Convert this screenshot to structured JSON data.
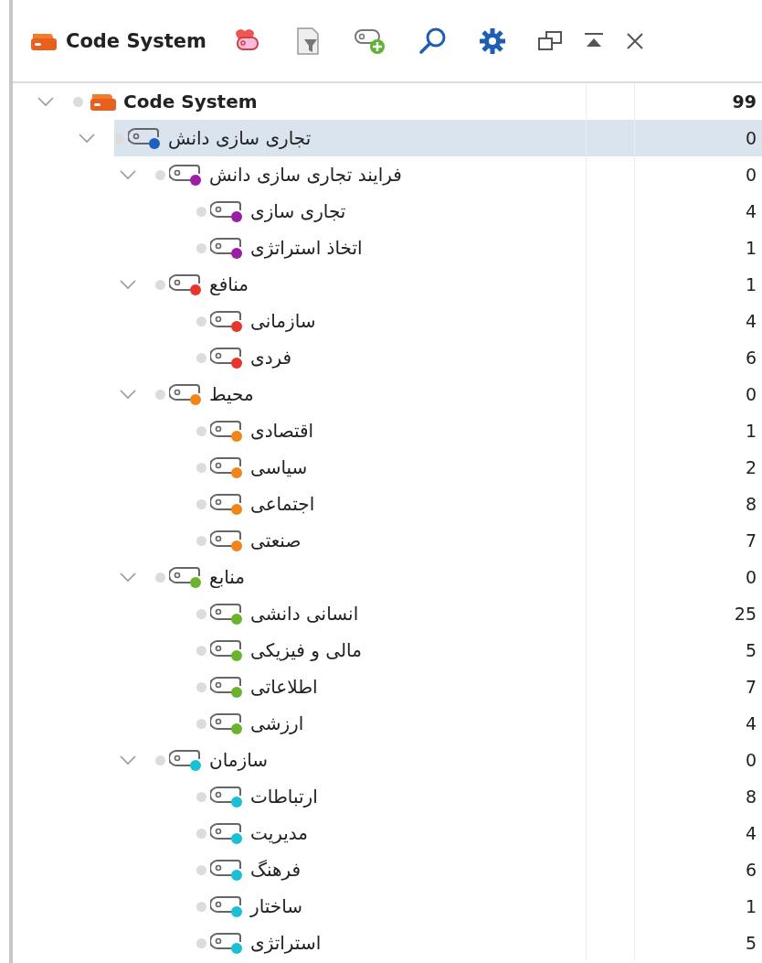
{
  "toolbar": {
    "title": "Code System"
  },
  "tree": [
    {
      "kind": "system",
      "label": "Code System",
      "count": "99",
      "selected": false,
      "expanded": true,
      "children": [
        {
          "kind": "code",
          "label": "تجاری سازی دانش",
          "count": "0",
          "color": "#1f5fbf",
          "selected": true,
          "expanded": true,
          "children": [
            {
              "kind": "code",
              "label": "فرایند تجاری سازی دانش",
              "count": "0",
              "color": "#9b1fa6",
              "selected": false,
              "expanded": true,
              "children": [
                {
                  "kind": "code",
                  "label": "تجاری سازی",
                  "count": "4",
                  "color": "#9b1fa6",
                  "selected": false
                },
                {
                  "kind": "code",
                  "label": "اتخاذ استراتژی",
                  "count": "1",
                  "color": "#9b1fa6",
                  "selected": false
                }
              ]
            },
            {
              "kind": "code",
              "label": "منافع",
              "count": "1",
              "color": "#e8352b",
              "selected": false,
              "expanded": true,
              "children": [
                {
                  "kind": "code",
                  "label": "سازمانی",
                  "count": "4",
                  "color": "#e8352b",
                  "selected": false
                },
                {
                  "kind": "code",
                  "label": "فردی",
                  "count": "6",
                  "color": "#e8352b",
                  "selected": false
                }
              ]
            },
            {
              "kind": "code",
              "label": "محیط",
              "count": "0",
              "color": "#f08519",
              "selected": false,
              "expanded": true,
              "children": [
                {
                  "kind": "code",
                  "label": "اقتصادی",
                  "count": "1",
                  "color": "#f08519",
                  "selected": false
                },
                {
                  "kind": "code",
                  "label": "سیاسی",
                  "count": "2",
                  "color": "#f08519",
                  "selected": false
                },
                {
                  "kind": "code",
                  "label": "اجتماعی",
                  "count": "8",
                  "color": "#f08519",
                  "selected": false
                },
                {
                  "kind": "code",
                  "label": "صنعتی",
                  "count": "7",
                  "color": "#f08519",
                  "selected": false
                }
              ]
            },
            {
              "kind": "code",
              "label": "منابع",
              "count": "0",
              "color": "#6ab42d",
              "selected": false,
              "expanded": true,
              "children": [
                {
                  "kind": "code",
                  "label": "انسانی دانشی",
                  "count": "25",
                  "color": "#6ab42d",
                  "selected": false
                },
                {
                  "kind": "code",
                  "label": "مالی و فیزیکی",
                  "count": "5",
                  "color": "#6ab42d",
                  "selected": false
                },
                {
                  "kind": "code",
                  "label": "اطلاعاتی",
                  "count": "7",
                  "color": "#6ab42d",
                  "selected": false
                },
                {
                  "kind": "code",
                  "label": "ارزشی",
                  "count": "4",
                  "color": "#6ab42d",
                  "selected": false
                }
              ]
            },
            {
              "kind": "code",
              "label": "سازمان",
              "count": "0",
              "color": "#19c0d6",
              "selected": false,
              "expanded": true,
              "children": [
                {
                  "kind": "code",
                  "label": "ارتباطات",
                  "count": "8",
                  "color": "#19c0d6",
                  "selected": false
                },
                {
                  "kind": "code",
                  "label": "مدیریت",
                  "count": "4",
                  "color": "#19c0d6",
                  "selected": false
                },
                {
                  "kind": "code",
                  "label": "فرهنگ",
                  "count": "6",
                  "color": "#19c0d6",
                  "selected": false
                },
                {
                  "kind": "code",
                  "label": "ساختار",
                  "count": "1",
                  "color": "#19c0d6",
                  "selected": false
                },
                {
                  "kind": "code",
                  "label": "استراتژی",
                  "count": "5",
                  "color": "#19c0d6",
                  "selected": false
                }
              ]
            }
          ]
        }
      ]
    }
  ]
}
